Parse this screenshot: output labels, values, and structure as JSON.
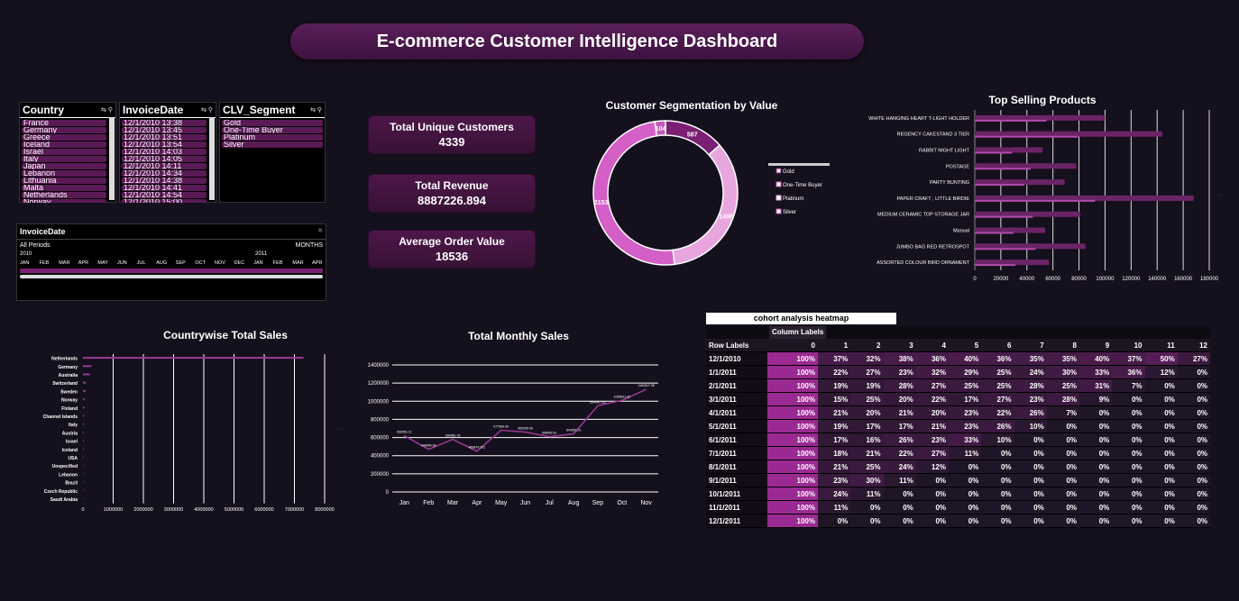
{
  "title": "E-commerce Customer Intelligence Dashboard",
  "slicers": {
    "country": {
      "header": "Country",
      "items": [
        "France",
        "Germany",
        "Greece",
        "Iceland",
        "Israel",
        "Italy",
        "Japan",
        "Lebanon",
        "Lithuania",
        "Malta",
        "Netherlands",
        "Norway"
      ]
    },
    "invoice_date": {
      "header": "InvoiceDate",
      "items": [
        "12/1/2010 13:38",
        "12/1/2010 13:45",
        "12/1/2010 13:51",
        "12/1/2010 13:54",
        "12/1/2010 14:03",
        "12/1/2010 14:05",
        "12/1/2010 14:11",
        "12/1/2010 14:34",
        "12/1/2010 14:38",
        "12/1/2010 14:41",
        "12/1/2010 14:54",
        "12/1/2010 15:00"
      ]
    },
    "clv_segment": {
      "header": "CLV_Segment",
      "items": [
        "Gold",
        "One-Time Buyer",
        "Platinum",
        "Silver"
      ]
    }
  },
  "timeline": {
    "header": "InvoiceDate",
    "period_label": "All Periods",
    "level": "MONTHS",
    "year1": "2010",
    "year2": "2011",
    "months": [
      "JAN",
      "FEB",
      "MAR",
      "APR",
      "MAY",
      "JUN",
      "JUL",
      "AUG",
      "SEP",
      "OCT",
      "NOV",
      "DEC",
      "JAN",
      "FEB",
      "MAR",
      "APR"
    ]
  },
  "kpis": [
    {
      "label": "Total Unique Customers",
      "value": "4339"
    },
    {
      "label": "Total Revenue",
      "value": "8887226.894"
    },
    {
      "label": "Average Order Value",
      "value": "18536"
    }
  ],
  "colors": {
    "accent": "#5b1f59",
    "bar": "#6b2466",
    "donut": [
      "#7a1f74",
      "#d45fc6",
      "#e8a6df",
      "#c45ab8"
    ]
  },
  "chart_data": [
    {
      "type": "pie",
      "title": "Customer Segmentation by Value",
      "labels": [
        "Gold",
        "One-Time Buyer",
        "Platinum",
        "Silver"
      ],
      "values": [
        587,
        2153,
        1496,
        104
      ],
      "slice_order": [
        "Gold",
        "Platinum",
        "One-Time Buyer",
        "Silver"
      ],
      "legend": "right"
    },
    {
      "type": "bar",
      "title": "Top Selling Products",
      "categories": [
        "WHITE HANGING HEART T-LIGHT HOLDER",
        "REGENCY CAKESTAND 3 TIER",
        "RABBIT NIGHT LIGHT",
        "POSTAGE",
        "PARTY BUNTING",
        "PAPER CRAFT , LITTLE BIRDIE",
        "MEDIUM CERAMIC TOP STORAGE JAR",
        "Manual",
        "JUMBO BAG RED RETROSPOT",
        "ASSORTED COLOUR BIRD ORNAMENT"
      ],
      "values": [
        100000,
        144000,
        52000,
        78000,
        69000,
        168000,
        81000,
        54000,
        85000,
        57000
      ],
      "xlim": [
        0,
        180000
      ],
      "ticks": [
        "0",
        "20000",
        "40000",
        "60000",
        "80000",
        "100000",
        "120000",
        "140000",
        "160000",
        "180000"
      ]
    },
    {
      "type": "bar",
      "title": "Countrywise Total Sales",
      "categories": [
        "Netherlands",
        "Germany",
        "Australia",
        "Switzerland",
        "Sweden",
        "Norway",
        "Finland",
        "Channel Islands",
        "Italy",
        "Austria",
        "Israel",
        "Iceland",
        "USA",
        "Unspecified",
        "Lebanon",
        "Brazil",
        "Czech Republic",
        "Saudi Arabia"
      ],
      "values": [
        7300000,
        285000,
        220000,
        100000,
        90000,
        52000,
        40000,
        35000,
        30000,
        28000,
        27000,
        25000,
        20000,
        15000,
        10000,
        8000,
        3000,
        1000
      ],
      "xlim": [
        0,
        8000000
      ],
      "ticks": [
        "0",
        "1000000",
        "2000000",
        "3000000",
        "4000000",
        "5000000",
        "6000000",
        "7000000",
        "8000000"
      ]
    },
    {
      "type": "line",
      "title": "Total Monthly Sales",
      "categories": [
        "Jan",
        "Feb",
        "Mar",
        "Apr",
        "May",
        "Jun",
        "Jul",
        "Aug",
        "Sep",
        "Oct",
        "Nov"
      ],
      "values": [
        620000,
        470000,
        580000,
        450000,
        680000,
        660000,
        610000,
        640000,
        950000,
        1010000,
        1130000
      ],
      "value_labels": [
        "590551.11",
        "446084.93",
        "594081.76",
        "469874.201",
        "677589.93",
        "660035.09",
        "598962.61",
        "644051.01",
        "950690.202",
        "1035641.41",
        "1161817.38"
      ],
      "ylim": [
        0,
        1400000
      ],
      "ticks": [
        "0",
        "200000",
        "400000",
        "600000",
        "800000",
        "1000000",
        "1200000",
        "1400000"
      ]
    }
  ],
  "cohort": {
    "title": "cohort analysis heatmap",
    "column_labels": "Column Labels",
    "row_labels": "Row Labels",
    "headers": [
      "0",
      "1",
      "2",
      "3",
      "4",
      "5",
      "6",
      "7",
      "8",
      "9",
      "10",
      "11",
      "12"
    ],
    "rows": [
      {
        "label": "12/1/2010",
        "values": [
          "100%",
          "37%",
          "32%",
          "38%",
          "36%",
          "40%",
          "36%",
          "35%",
          "35%",
          "40%",
          "37%",
          "50%",
          "27%"
        ]
      },
      {
        "label": "1/1/2011",
        "values": [
          "100%",
          "22%",
          "27%",
          "23%",
          "32%",
          "29%",
          "25%",
          "24%",
          "30%",
          "33%",
          "36%",
          "12%",
          "0%"
        ]
      },
      {
        "label": "2/1/2011",
        "values": [
          "100%",
          "19%",
          "19%",
          "28%",
          "27%",
          "25%",
          "25%",
          "28%",
          "25%",
          "31%",
          "7%",
          "0%",
          "0%"
        ]
      },
      {
        "label": "3/1/2011",
        "values": [
          "100%",
          "15%",
          "25%",
          "20%",
          "22%",
          "17%",
          "27%",
          "23%",
          "28%",
          "9%",
          "0%",
          "0%",
          "0%"
        ]
      },
      {
        "label": "4/1/2011",
        "values": [
          "100%",
          "21%",
          "20%",
          "21%",
          "20%",
          "23%",
          "22%",
          "26%",
          "7%",
          "0%",
          "0%",
          "0%",
          "0%"
        ]
      },
      {
        "label": "5/1/2011",
        "values": [
          "100%",
          "19%",
          "17%",
          "17%",
          "21%",
          "23%",
          "26%",
          "10%",
          "0%",
          "0%",
          "0%",
          "0%",
          "0%"
        ]
      },
      {
        "label": "6/1/2011",
        "values": [
          "100%",
          "17%",
          "16%",
          "26%",
          "23%",
          "33%",
          "10%",
          "0%",
          "0%",
          "0%",
          "0%",
          "0%",
          "0%"
        ]
      },
      {
        "label": "7/1/2011",
        "values": [
          "100%",
          "18%",
          "21%",
          "22%",
          "27%",
          "11%",
          "0%",
          "0%",
          "0%",
          "0%",
          "0%",
          "0%",
          "0%"
        ]
      },
      {
        "label": "8/1/2011",
        "values": [
          "100%",
          "21%",
          "25%",
          "24%",
          "12%",
          "0%",
          "0%",
          "0%",
          "0%",
          "0%",
          "0%",
          "0%",
          "0%"
        ]
      },
      {
        "label": "9/1/2011",
        "values": [
          "100%",
          "23%",
          "30%",
          "11%",
          "0%",
          "0%",
          "0%",
          "0%",
          "0%",
          "0%",
          "0%",
          "0%",
          "0%"
        ]
      },
      {
        "label": "10/1/2011",
        "values": [
          "100%",
          "24%",
          "11%",
          "0%",
          "0%",
          "0%",
          "0%",
          "0%",
          "0%",
          "0%",
          "0%",
          "0%",
          "0%"
        ]
      },
      {
        "label": "11/1/2011",
        "values": [
          "100%",
          "11%",
          "0%",
          "0%",
          "0%",
          "0%",
          "0%",
          "0%",
          "0%",
          "0%",
          "0%",
          "0%",
          "0%"
        ]
      },
      {
        "label": "12/1/2011",
        "values": [
          "100%",
          "0%",
          "0%",
          "0%",
          "0%",
          "0%",
          "0%",
          "0%",
          "0%",
          "0%",
          "0%",
          "0%",
          "0%"
        ]
      }
    ]
  }
}
